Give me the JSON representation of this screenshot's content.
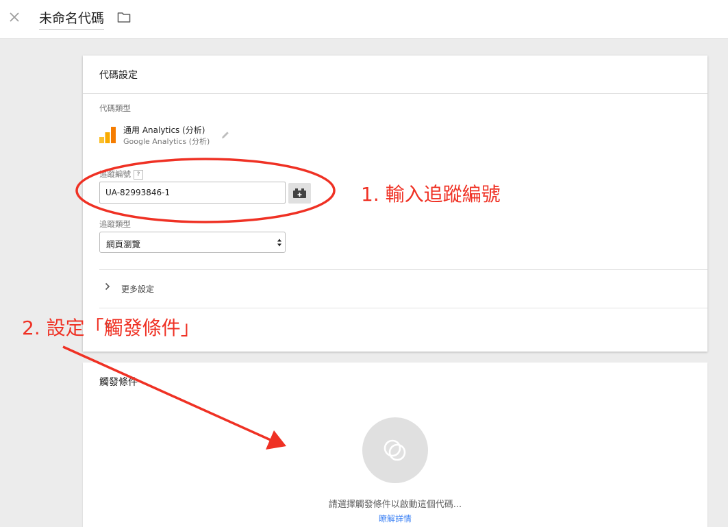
{
  "header": {
    "tag_name": "未命名代碼",
    "close_icon": "close-icon",
    "folder_icon": "folder-icon"
  },
  "config_card": {
    "title": "代碼設定",
    "tag_type_label": "代碼類型",
    "tag_type_name": "通用 Analytics (分析)",
    "tag_type_sub": "Google Analytics (分析)",
    "tracking_id_label": "追蹤編號",
    "help_badge": "?",
    "tracking_id_value": "UA-82993846-1",
    "track_type_label": "追蹤類型",
    "track_type_value": "網頁瀏覽",
    "more_settings_label": "更多設定"
  },
  "triggers_card": {
    "title": "觸發條件",
    "prompt": "請選擇觸發條件以啟動這個代碼...",
    "learn_more": "瞭解詳情"
  },
  "annotations": {
    "step1": "1. 輸入追蹤編號",
    "step2": "2. 設定「觸發條件」"
  },
  "colors": {
    "annotation_red": "#ef3124",
    "link_blue": "#4285f4",
    "analytics_orange": "#f9ab00",
    "analytics_yellow": "#fbc02d"
  }
}
